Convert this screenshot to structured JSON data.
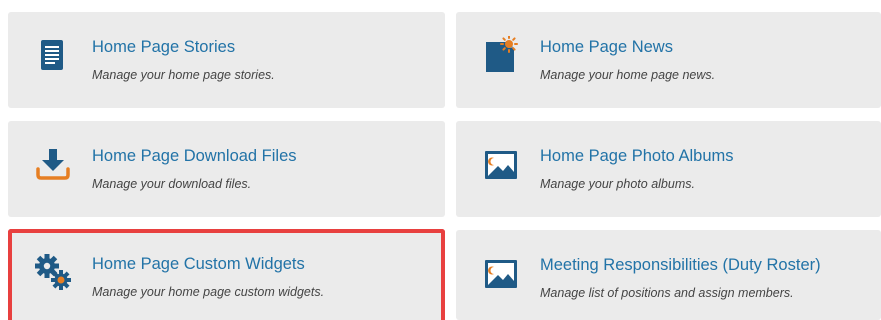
{
  "colors": {
    "card_bg": "#ebebeb",
    "title": "#2273a7",
    "icon_blue": "#1f5a86",
    "accent_orange": "#e67e22",
    "highlight_border": "#e8403f"
  },
  "cards": [
    {
      "title": "Home Page Stories",
      "description": "Manage your home page stories.",
      "icon": "document-list-icon"
    },
    {
      "title": "Home Page News",
      "description": "Manage your home page news.",
      "icon": "news-document-icon"
    },
    {
      "title": "Home Page Download Files",
      "description": "Manage your download files.",
      "icon": "download-icon"
    },
    {
      "title": "Home Page Photo Albums",
      "description": "Manage your photo albums.",
      "icon": "photo-icon"
    },
    {
      "title": "Home Page Custom Widgets",
      "description": "Manage your home page custom widgets.",
      "icon": "gears-icon",
      "selected": true
    },
    {
      "title": "Meeting Responsibilities (Duty Roster)",
      "description": "Manage list of positions and assign members.",
      "icon": "photo-icon"
    }
  ]
}
